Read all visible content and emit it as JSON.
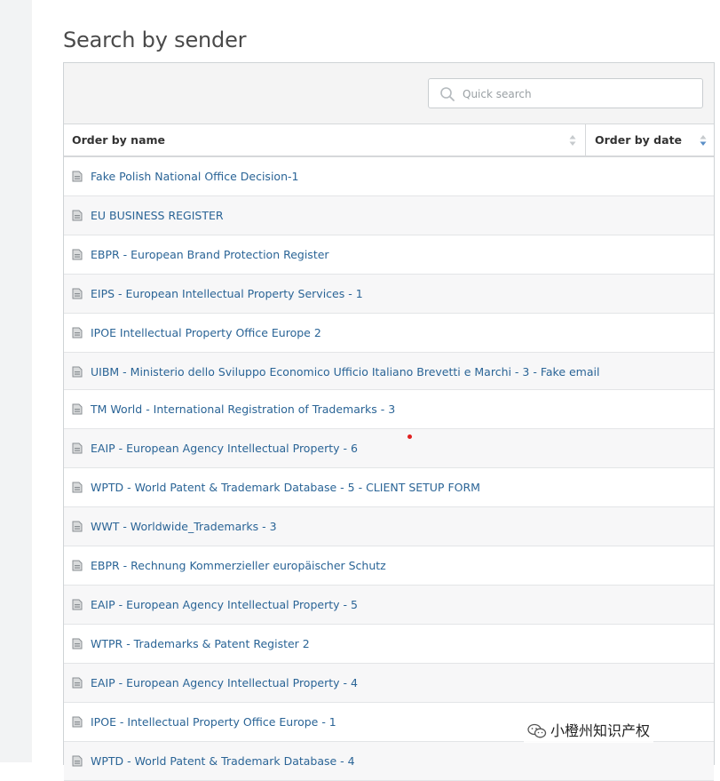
{
  "page": {
    "title": "Search by sender"
  },
  "search": {
    "placeholder": "Quick search",
    "value": ""
  },
  "columns": {
    "name_label": "Order by name",
    "date_label": "Order by date"
  },
  "rows": [
    {
      "label": "Fake Polish National Office Decision-1"
    },
    {
      "label": "EU BUSINESS REGISTER"
    },
    {
      "label": "EBPR - European Brand Protection Register"
    },
    {
      "label": "EIPS - European Intellectual Property Services - 1"
    },
    {
      "label": "IPOE Intellectual Property Office Europe 2"
    },
    {
      "label": "UIBM - Ministerio dello Sviluppo Economico Ufficio Italiano Brevetti e Marchi - 3 - Fake email"
    },
    {
      "label": "TM World - International Registration of Trademarks - 3"
    },
    {
      "label": "EAIP - European Agency Intellectual Property - 6"
    },
    {
      "label": "WPTD - World Patent & Trademark Database - 5 - CLIENT SETUP FORM"
    },
    {
      "label": "WWT - Worldwide_Trademarks - 3"
    },
    {
      "label": "EBPR - Rechnung Kommerzieller europäischer Schutz"
    },
    {
      "label": "EAIP - European Agency Intellectual Property - 5"
    },
    {
      "label": "WTPR - Trademarks & Patent Register 2"
    },
    {
      "label": "EAIP - European Agency Intellectual Property - 4"
    },
    {
      "label": "IPOE - Intellectual Property Office Europe - 1"
    },
    {
      "label": "WPTD - World Patent & Trademark Database - 4"
    }
  ],
  "watermark": {
    "text": "小橙州知识产权"
  },
  "colors": {
    "link": "#2a6496",
    "alt_row": "#f7f7f8",
    "toolbar": "#f4f4f4"
  }
}
